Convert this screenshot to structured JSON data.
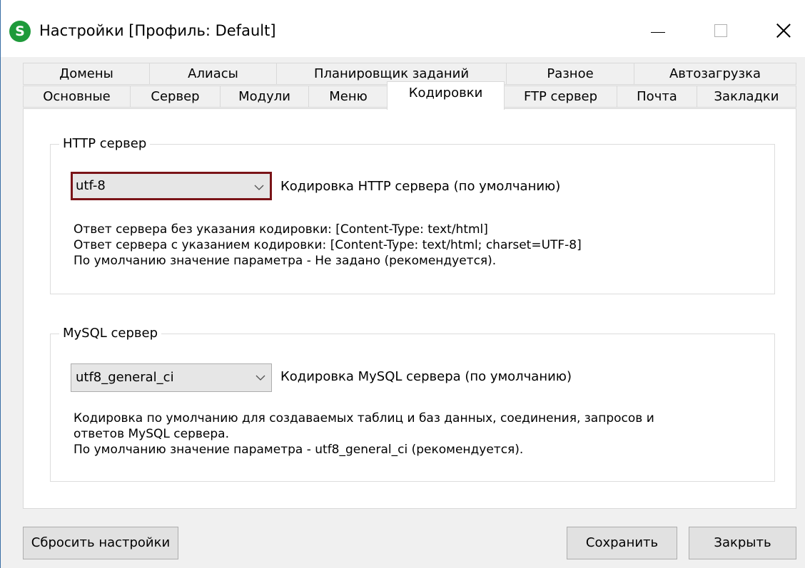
{
  "window": {
    "icon_letter": "S",
    "title": "Настройки [Профиль: Default]"
  },
  "tabs": {
    "row1": [
      "Домены",
      "Алиасы",
      "Планировщик заданий",
      "Разное",
      "Автозагрузка"
    ],
    "row2": [
      "Основные",
      "Сервер",
      "Модули",
      "Меню",
      "Кодировки",
      "FTP сервер",
      "Почта",
      "Закладки"
    ],
    "active": "Кодировки"
  },
  "http": {
    "legend": "HTTP сервер",
    "encoding_value": "utf-8",
    "encoding_label": "Кодировка HTTP сервера (по умолчанию)",
    "info_lines": [
      "Ответ сервера без указания кодировки: [Content-Type: text/html]",
      "Ответ сервера с указанием кодировки:   [Content-Type: text/html; charset=UTF-8]",
      "По умолчанию значение параметра - Не задано (рекомендуется)."
    ]
  },
  "mysql": {
    "legend": "MySQL сервер",
    "encoding_value": "utf8_general_ci",
    "encoding_label": "Кодировка MySQL сервера (по умолчанию)",
    "info_lines": [
      "Кодировка по умолчанию для создаваемых таблиц и баз данных, соединения, запросов и",
      "ответов MySQL сервера.",
      "По умолчанию значение параметра - utf8_general_ci (рекомендуется)."
    ]
  },
  "buttons": {
    "reset": "Сбросить настройки",
    "save": "Сохранить",
    "close": "Закрыть"
  },
  "colors": {
    "focus_border": "#7a1418",
    "app_icon": "#1e9a3a"
  }
}
